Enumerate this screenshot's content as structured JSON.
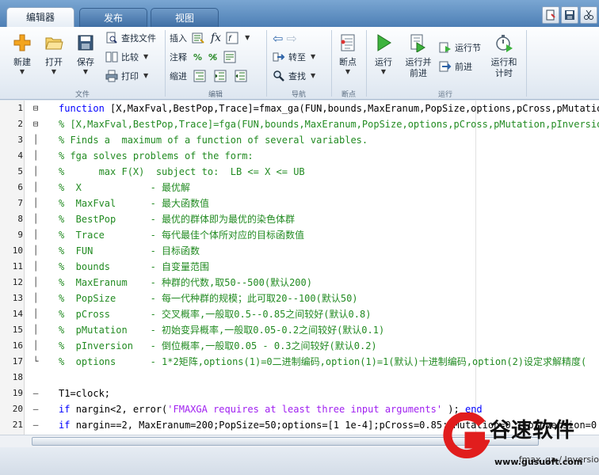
{
  "tabs": [
    {
      "label": "编辑器",
      "active": true
    },
    {
      "label": "发布",
      "active": false
    },
    {
      "label": "视图",
      "active": false
    }
  ],
  "ribbon": {
    "file": {
      "new": "新建",
      "open": "打开",
      "save": "保存",
      "find_file": "查找文件",
      "compare": "比较",
      "print": "打印",
      "group": "文件"
    },
    "edit": {
      "insert": "插入",
      "comment": "注释",
      "indent": "缩进",
      "group": "编辑"
    },
    "navigate": {
      "goto": "转至",
      "find": "查找",
      "group": "导航"
    },
    "breakpoints": {
      "label": "断点",
      "group": "断点"
    },
    "run": {
      "run": "运行",
      "run_advance_1": "运行并",
      "run_advance_2": "前进",
      "run_section": "运行节",
      "advance": "前进",
      "run_time_1": "运行和",
      "run_time_2": "计时",
      "group": "运行"
    }
  },
  "editor": {
    "lines": [
      {
        "n": "1",
        "fold": "⊟",
        "parts": [
          [
            "kw",
            "function "
          ],
          [
            "",
            "[X,MaxFval,BestPop,Trace]=fmax_ga(FUN,bounds,MaxEranum,PopSize,options,pCross,pMutation,p"
          ]
        ]
      },
      {
        "n": "2",
        "fold": "⊟",
        "parts": [
          [
            "cm",
            "% [X,MaxFval,BestPop,Trace]=fga(FUN,bounds,MaxEranum,PopSize,options,pCross,pMutation,pInversion)"
          ]
        ]
      },
      {
        "n": "3",
        "fold": "│",
        "parts": [
          [
            "cm",
            "% Finds a  maximum of a function of several variables."
          ]
        ]
      },
      {
        "n": "4",
        "fold": "│",
        "parts": [
          [
            "cm",
            "% fga solves problems of the form:"
          ]
        ]
      },
      {
        "n": "5",
        "fold": "│",
        "parts": [
          [
            "cm",
            "%      max F(X)  subject to:  LB <= X <= UB"
          ]
        ]
      },
      {
        "n": "6",
        "fold": "│",
        "parts": [
          [
            "cm",
            "%  X            - 最优解"
          ]
        ]
      },
      {
        "n": "7",
        "fold": "│",
        "parts": [
          [
            "cm",
            "%  MaxFval      - 最大函数值"
          ]
        ]
      },
      {
        "n": "8",
        "fold": "│",
        "parts": [
          [
            "cm",
            "%  BestPop      - 最优的群体即为最优的染色体群"
          ]
        ]
      },
      {
        "n": "9",
        "fold": "│",
        "parts": [
          [
            "cm",
            "%  Trace        - 每代最佳个体所对应的目标函数值"
          ]
        ]
      },
      {
        "n": "10",
        "fold": "│",
        "parts": [
          [
            "cm",
            "%  FUN          - 目标函数"
          ]
        ]
      },
      {
        "n": "11",
        "fold": "│",
        "parts": [
          [
            "cm",
            "%  bounds       - 自变量范围"
          ]
        ]
      },
      {
        "n": "12",
        "fold": "│",
        "parts": [
          [
            "cm",
            "%  MaxEranum    - 种群的代数,取50--500(默认200)"
          ]
        ]
      },
      {
        "n": "13",
        "fold": "│",
        "parts": [
          [
            "cm",
            "%  PopSize      - 每一代种群的规模；此可取20--100(默认50)"
          ]
        ]
      },
      {
        "n": "14",
        "fold": "│",
        "parts": [
          [
            "cm",
            "%  pCross       - 交叉概率,一般取0.5--0.85之间较好(默认0.8)"
          ]
        ]
      },
      {
        "n": "15",
        "fold": "│",
        "parts": [
          [
            "cm",
            "%  pMutation    - 初始变异概率,一般取0.05-0.2之间较好(默认0.1)"
          ]
        ]
      },
      {
        "n": "16",
        "fold": "│",
        "parts": [
          [
            "cm",
            "%  pInversion   - 倒位概率,一般取0.05 - 0.3之间较好(默认0.2)"
          ]
        ]
      },
      {
        "n": "17",
        "fold": "└",
        "parts": [
          [
            "cm",
            "%  options      - 1*2矩阵,options(1)=0二进制编码,option(1)=1(默认)十进制编码,option(2)设定求解精度("
          ]
        ]
      },
      {
        "n": "18",
        "fold": "",
        "parts": [
          [
            "",
            ""
          ]
        ]
      },
      {
        "n": "19",
        "fold": "–",
        "parts": [
          [
            "",
            "T1=clock;"
          ]
        ]
      },
      {
        "n": "20",
        "fold": "–",
        "parts": [
          [
            "kw",
            "if "
          ],
          [
            "",
            "nargin<2, error("
          ],
          [
            "st",
            "'FMAXGA requires at least three input arguments'"
          ],
          [
            "",
            " ); "
          ],
          [
            "kw",
            "end"
          ]
        ]
      },
      {
        "n": "21",
        "fold": "–",
        "parts": [
          [
            "kw",
            "if "
          ],
          [
            "",
            "nargin==2, MaxEranum=200;PopSize=50;options=[1 1e-4];pCross=0.85;pMutation=0.1;pInversion=0.25"
          ]
        ]
      }
    ]
  },
  "status": {
    "file": "fmax_ga / Inversio"
  },
  "watermark": {
    "brand": "谷速软件",
    "url": "www.gusuoft.com"
  },
  "colors": {
    "keyword": "#0000ff",
    "comment": "#228b22",
    "string": "#a020f0",
    "tab_bar": "#4d7fb5",
    "watermark_red": "#e11d1d"
  }
}
